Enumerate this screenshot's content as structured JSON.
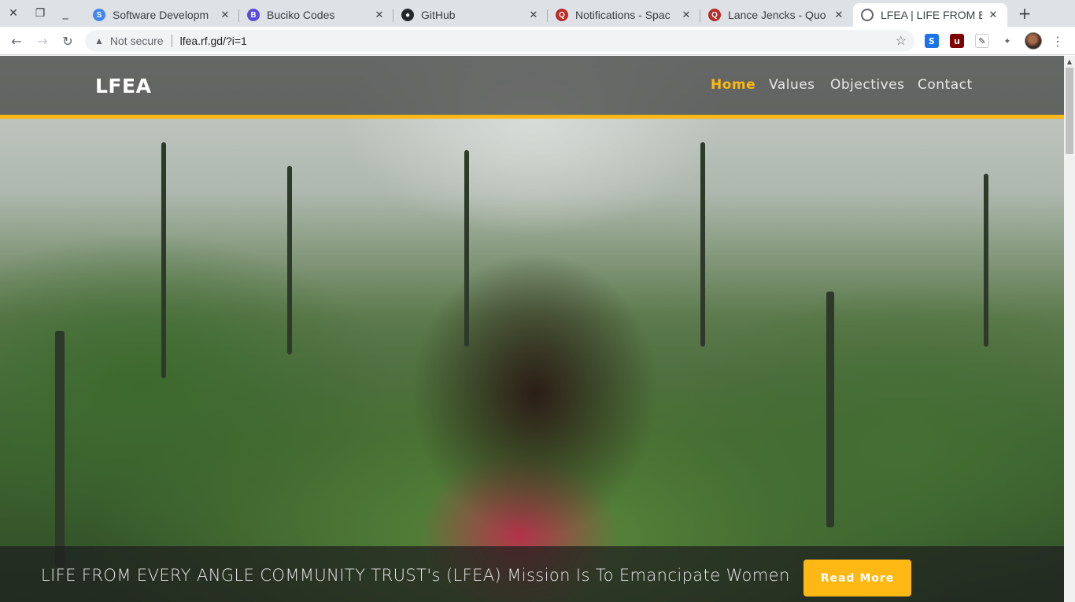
{
  "browser": {
    "tabs": [
      {
        "title": "Software Developm",
        "icon": "stackshare-icon",
        "color": "#4285f4"
      },
      {
        "title": "Buciko Codes",
        "icon": "buciko-icon",
        "color": "#5b4bdb"
      },
      {
        "title": "GitHub",
        "icon": "github-icon",
        "color": "#24292e"
      },
      {
        "title": "Notifications - Spac",
        "icon": "quora-icon",
        "color": "#b92b27"
      },
      {
        "title": "Lance Jencks - Quo",
        "icon": "quora-icon",
        "color": "#b92b27"
      },
      {
        "title": "LFEA | LIFE FROM E",
        "icon": "globe-icon",
        "color": "#5f6368"
      }
    ],
    "address": {
      "security_label": "Not secure",
      "url": "lfea.rf.gd/?i=1"
    }
  },
  "site": {
    "brand": "LFEA",
    "nav": {
      "home": "Home",
      "values": "Values",
      "objectives": "Objectives",
      "contact": "Contact"
    },
    "hero": {
      "caption": "LIFE FROM EVERY ANGLE COMMUNITY TRUST's (LFEA) Mission Is To Emancipate Women",
      "button": "Read More"
    },
    "accent_color": "#fdb813"
  }
}
